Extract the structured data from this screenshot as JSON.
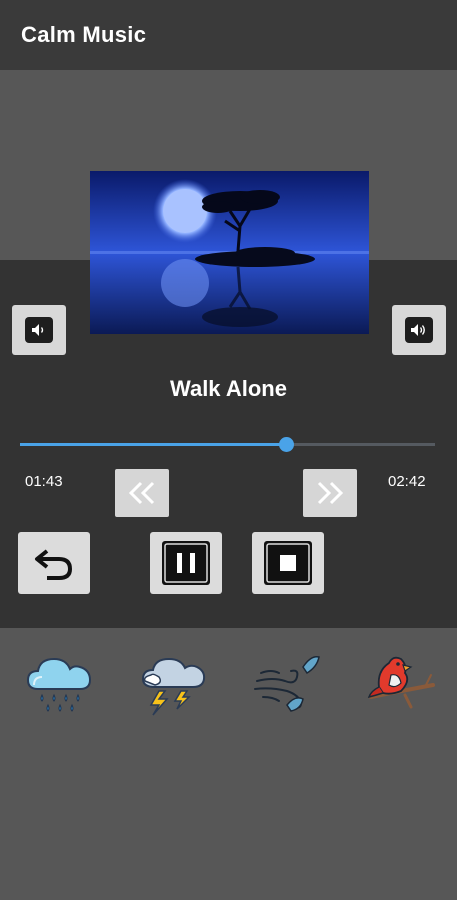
{
  "app": {
    "title": "Calm Music"
  },
  "player": {
    "track_title": "Walk Alone",
    "elapsed": "01:43",
    "duration": "02:42",
    "progress": 0.64
  },
  "buttons": {
    "volume_left_icon": "speaker-icon",
    "volume_right_icon": "speaker-icon",
    "rewind_icon": "double-chevron-left-icon",
    "forward_icon": "double-chevron-right-icon",
    "replay_icon": "undo-arrow-icon",
    "pause_icon": "pause-icon",
    "stop_icon": "stop-icon"
  },
  "sounds": [
    {
      "icon": "rain-cloud-icon"
    },
    {
      "icon": "thunderstorm-icon"
    },
    {
      "icon": "wind-leaves-icon"
    },
    {
      "icon": "cardinal-bird-icon"
    }
  ],
  "colors": {
    "accent": "#4aa3e8",
    "appbar": "#3a3a3a",
    "player_bg": "#333333",
    "page_bg": "#575757"
  }
}
